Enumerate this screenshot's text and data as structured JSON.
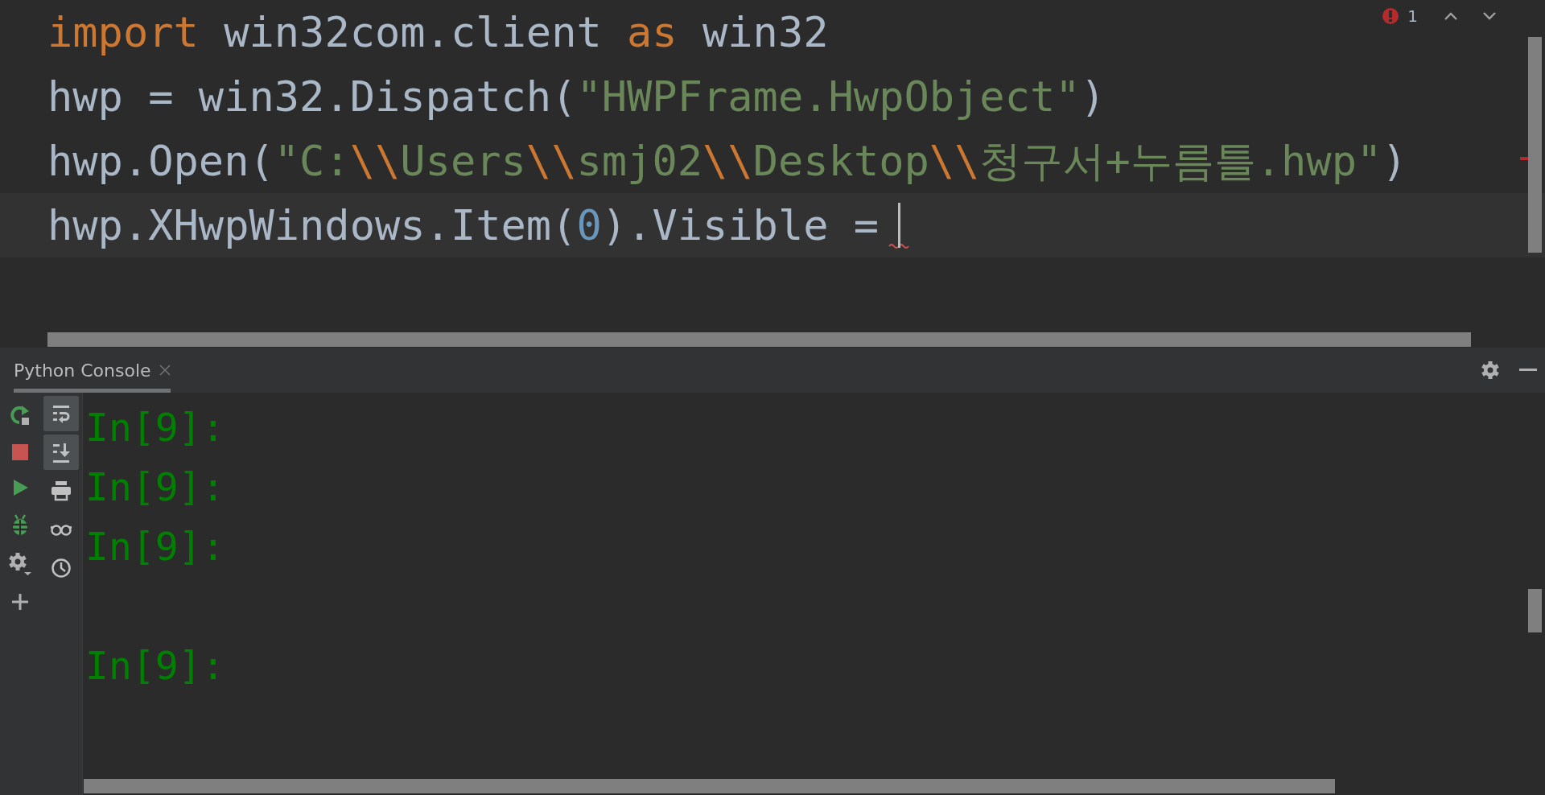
{
  "editor": {
    "error_count": "1",
    "lines": [
      {
        "current": false,
        "error": false,
        "tokens": [
          {
            "kind": "keyword",
            "text": "import"
          },
          {
            "kind": "plain",
            "text": " win32com.client "
          },
          {
            "kind": "keyword",
            "text": "as"
          },
          {
            "kind": "plain",
            "text": " win32"
          }
        ]
      },
      {
        "current": false,
        "error": false,
        "tokens": [
          {
            "kind": "plain",
            "text": "hwp = win32.Dispatch("
          },
          {
            "kind": "string",
            "text": "\"HWPFrame.HwpObject\""
          },
          {
            "kind": "plain",
            "text": ")"
          }
        ]
      },
      {
        "current": false,
        "error": false,
        "tokens": [
          {
            "kind": "plain",
            "text": "hwp.Open("
          },
          {
            "kind": "string",
            "text": "\"C:"
          },
          {
            "kind": "escape",
            "text": "\\\\"
          },
          {
            "kind": "string",
            "text": "Users"
          },
          {
            "kind": "escape",
            "text": "\\\\"
          },
          {
            "kind": "string",
            "text": "smj02"
          },
          {
            "kind": "escape",
            "text": "\\\\"
          },
          {
            "kind": "string",
            "text": "Desktop"
          },
          {
            "kind": "escape",
            "text": "\\\\"
          },
          {
            "kind": "string",
            "text": "청구서+누름틀.hwp\""
          },
          {
            "kind": "plain",
            "text": ")"
          }
        ]
      },
      {
        "current": true,
        "error": true,
        "tokens": [
          {
            "kind": "plain",
            "text": "hwp.XHwpWindows.Item("
          },
          {
            "kind": "number",
            "text": "0"
          },
          {
            "kind": "plain",
            "text": ").Visible ="
          }
        ]
      }
    ]
  },
  "console": {
    "tab": {
      "label": "Python Console",
      "selected": true
    },
    "tools": [
      {
        "kind": "soft-wrap",
        "selected": true
      },
      {
        "kind": "scroll-end",
        "selected": true
      },
      {
        "kind": "print",
        "selected": false
      },
      {
        "kind": "glasses",
        "selected": false
      },
      {
        "kind": "history",
        "selected": false
      }
    ],
    "lines": [
      {
        "kind": "prompt",
        "text": "In[9]:"
      },
      {
        "kind": "prompt",
        "text": "In[9]:"
      },
      {
        "kind": "prompt",
        "text": "In[9]:"
      },
      {
        "kind": "blank"
      },
      {
        "kind": "prompt",
        "text": "In[9]:"
      }
    ]
  }
}
